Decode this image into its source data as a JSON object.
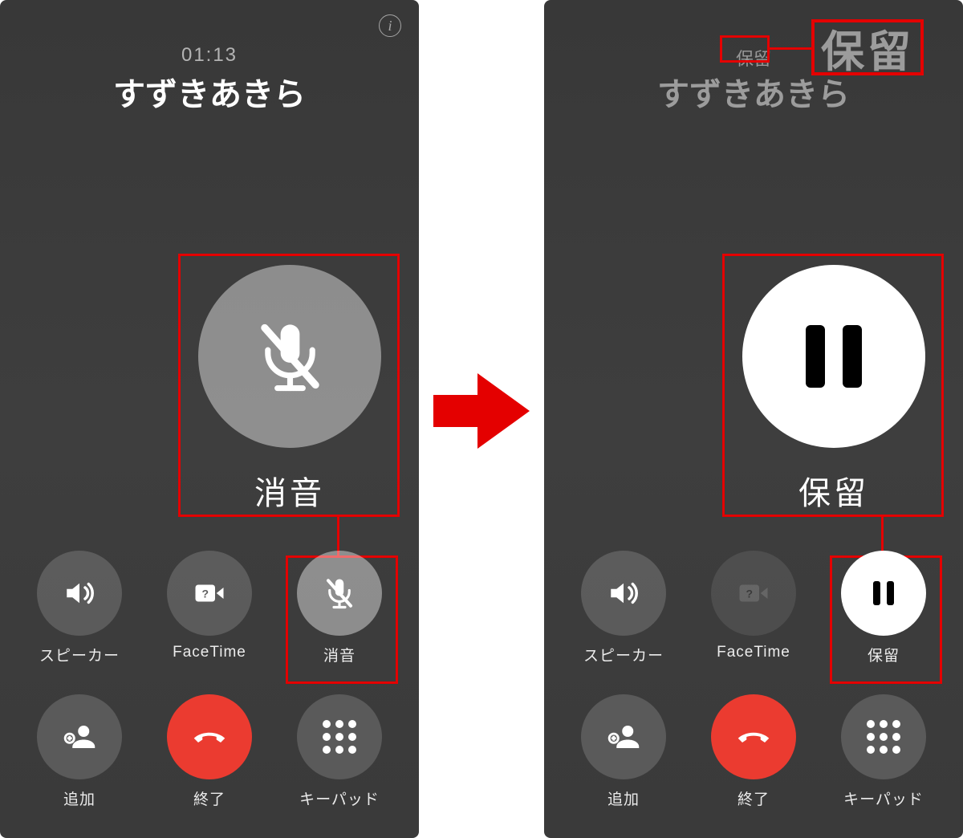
{
  "arrow_color": "#e40000",
  "left": {
    "timer": "01:13",
    "caller": "すずきあきら",
    "big_button": {
      "label": "消音"
    },
    "buttons": [
      {
        "key": "speaker",
        "label": "スピーカー"
      },
      {
        "key": "facetime",
        "label": "FaceTime"
      },
      {
        "key": "mute",
        "label": "消音"
      },
      {
        "key": "add",
        "label": "追加"
      },
      {
        "key": "end",
        "label": "終了"
      },
      {
        "key": "keypad",
        "label": "キーパッド"
      }
    ]
  },
  "right": {
    "status": "保留",
    "status_zoom": "保留",
    "caller": "すずきあきら",
    "big_button": {
      "label": "保留"
    },
    "buttons": [
      {
        "key": "speaker",
        "label": "スピーカー"
      },
      {
        "key": "facetime",
        "label": "FaceTime"
      },
      {
        "key": "hold",
        "label": "保留"
      },
      {
        "key": "add",
        "label": "追加"
      },
      {
        "key": "end",
        "label": "終了"
      },
      {
        "key": "keypad",
        "label": "キーパッド"
      }
    ]
  }
}
